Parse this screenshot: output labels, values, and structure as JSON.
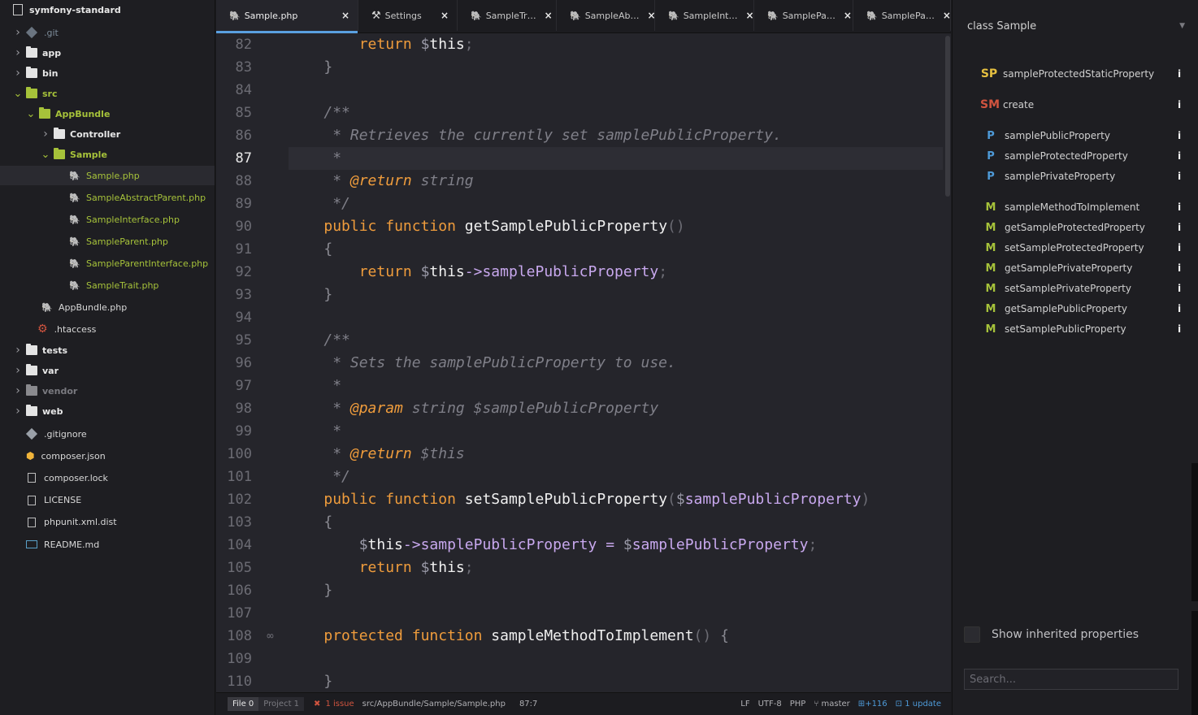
{
  "tree": {
    "root": "symfony-standard",
    "items": [
      {
        "label": ".git",
        "kind": "git-dim",
        "depth": 1,
        "chev": "closed"
      },
      {
        "label": "app",
        "kind": "folder",
        "depth": 1,
        "chev": "closed"
      },
      {
        "label": "bin",
        "kind": "folder",
        "depth": 1,
        "chev": "closed"
      },
      {
        "label": "src",
        "kind": "folder-green",
        "depth": 1,
        "chev": "open"
      },
      {
        "label": "AppBundle",
        "kind": "folder-green",
        "depth": 2,
        "chev": "open"
      },
      {
        "label": "Controller",
        "kind": "folder",
        "depth": 3,
        "chev": "closed"
      },
      {
        "label": "Sample",
        "kind": "folder-green",
        "depth": 3,
        "chev": "open"
      },
      {
        "label": "Sample.php",
        "kind": "php-green",
        "depth": 4,
        "chev": "none",
        "selected": true
      },
      {
        "label": "SampleAbstractParent.php",
        "kind": "php-green",
        "depth": 4,
        "chev": "none"
      },
      {
        "label": "SampleInterface.php",
        "kind": "php-green",
        "depth": 4,
        "chev": "none"
      },
      {
        "label": "SampleParent.php",
        "kind": "php-green",
        "depth": 4,
        "chev": "none"
      },
      {
        "label": "SampleParentInterface.php",
        "kind": "php-green",
        "depth": 4,
        "chev": "none"
      },
      {
        "label": "SampleTrait.php",
        "kind": "php-green",
        "depth": 4,
        "chev": "none"
      },
      {
        "label": "AppBundle.php",
        "kind": "php",
        "depth": 3,
        "chev": "none"
      },
      {
        "label": ".htaccess",
        "kind": "gear",
        "depth": 2,
        "chev": "none"
      },
      {
        "label": "tests",
        "kind": "folder",
        "depth": 1,
        "chev": "closed"
      },
      {
        "label": "var",
        "kind": "folder",
        "depth": 1,
        "chev": "closed"
      },
      {
        "label": "vendor",
        "kind": "folder-dim",
        "depth": 1,
        "chev": "closed"
      },
      {
        "label": "web",
        "kind": "folder",
        "depth": 1,
        "chev": "closed"
      },
      {
        "label": ".gitignore",
        "kind": "git",
        "depth": 1,
        "chev": "none"
      },
      {
        "label": "composer.json",
        "kind": "composer",
        "depth": 1,
        "chev": "none"
      },
      {
        "label": "composer.lock",
        "kind": "file",
        "depth": 1,
        "chev": "none"
      },
      {
        "label": "LICENSE",
        "kind": "file",
        "depth": 1,
        "chev": "none"
      },
      {
        "label": "phpunit.xml.dist",
        "kind": "file",
        "depth": 1,
        "chev": "none"
      },
      {
        "label": "README.md",
        "kind": "readme",
        "depth": 1,
        "chev": "none"
      }
    ]
  },
  "tabs": [
    {
      "label": "Sample.php",
      "icon": "php-icon",
      "active": true
    },
    {
      "label": "Settings",
      "icon": "tools-icon",
      "active": false
    },
    {
      "label": "SampleTr…",
      "icon": "php-icon",
      "active": false
    },
    {
      "label": "SampleAb…",
      "icon": "php-icon",
      "active": false
    },
    {
      "label": "SampleInt…",
      "icon": "php-icon",
      "active": false
    },
    {
      "label": "SamplePa…",
      "icon": "php-icon",
      "active": false
    },
    {
      "label": "SamplePa…",
      "icon": "php-icon",
      "active": false
    }
  ],
  "editor": {
    "current_line": 87,
    "lines": [
      {
        "n": "82",
        "t": [
          [
            "        ",
            ""
          ],
          [
            "return",
            "kw"
          ],
          [
            " ",
            ""
          ],
          [
            "$",
            "dollar"
          ],
          [
            "this",
            "fn"
          ],
          [
            ";",
            "punc"
          ]
        ]
      },
      {
        "n": "83",
        "t": [
          [
            "    ",
            ""
          ],
          [
            "}",
            "brace"
          ]
        ]
      },
      {
        "n": "84",
        "t": []
      },
      {
        "n": "85",
        "t": [
          [
            "    ",
            ""
          ],
          [
            "/**",
            "cmt"
          ]
        ]
      },
      {
        "n": "86",
        "t": [
          [
            "     ",
            ""
          ],
          [
            "* Retrieves the currently set samplePublicProperty.",
            "cmt"
          ]
        ]
      },
      {
        "n": "87",
        "t": [
          [
            "     ",
            ""
          ],
          [
            "*",
            "cmt"
          ]
        ]
      },
      {
        "n": "88",
        "t": [
          [
            "     ",
            ""
          ],
          [
            "* ",
            "cmt"
          ],
          [
            "@return",
            "tag"
          ],
          [
            " string",
            "cmt"
          ]
        ]
      },
      {
        "n": "89",
        "t": [
          [
            "     ",
            ""
          ],
          [
            "*/",
            "cmt"
          ]
        ]
      },
      {
        "n": "90",
        "t": [
          [
            "    ",
            ""
          ],
          [
            "public",
            "kw"
          ],
          [
            " ",
            ""
          ],
          [
            "function",
            "kw"
          ],
          [
            " ",
            ""
          ],
          [
            "getSamplePublicProperty",
            "fn"
          ],
          [
            "()",
            "punc"
          ]
        ]
      },
      {
        "n": "91",
        "t": [
          [
            "    ",
            ""
          ],
          [
            "{",
            "brace"
          ]
        ]
      },
      {
        "n": "92",
        "t": [
          [
            "        ",
            ""
          ],
          [
            "return",
            "kw"
          ],
          [
            " ",
            ""
          ],
          [
            "$",
            "dollar"
          ],
          [
            "this",
            "fn"
          ],
          [
            "->",
            "op"
          ],
          [
            "samplePublicProperty",
            "var"
          ],
          [
            ";",
            "punc"
          ]
        ]
      },
      {
        "n": "93",
        "t": [
          [
            "    ",
            ""
          ],
          [
            "}",
            "brace"
          ]
        ]
      },
      {
        "n": "94",
        "t": []
      },
      {
        "n": "95",
        "t": [
          [
            "    ",
            ""
          ],
          [
            "/**",
            "cmt"
          ]
        ]
      },
      {
        "n": "96",
        "t": [
          [
            "     ",
            ""
          ],
          [
            "* Sets the samplePublicProperty to use.",
            "cmt"
          ]
        ]
      },
      {
        "n": "97",
        "t": [
          [
            "     ",
            ""
          ],
          [
            "*",
            "cmt"
          ]
        ]
      },
      {
        "n": "98",
        "t": [
          [
            "     ",
            ""
          ],
          [
            "* ",
            "cmt"
          ],
          [
            "@param",
            "tag"
          ],
          [
            " string $samplePublicProperty",
            "cmt"
          ]
        ]
      },
      {
        "n": "99",
        "t": [
          [
            "     ",
            ""
          ],
          [
            "*",
            "cmt"
          ]
        ]
      },
      {
        "n": "100",
        "t": [
          [
            "     ",
            ""
          ],
          [
            "* ",
            "cmt"
          ],
          [
            "@return",
            "tag"
          ],
          [
            " $this",
            "cmt"
          ]
        ]
      },
      {
        "n": "101",
        "t": [
          [
            "     ",
            ""
          ],
          [
            "*/",
            "cmt"
          ]
        ]
      },
      {
        "n": "102",
        "t": [
          [
            "    ",
            ""
          ],
          [
            "public",
            "kw"
          ],
          [
            " ",
            ""
          ],
          [
            "function",
            "kw"
          ],
          [
            " ",
            ""
          ],
          [
            "setSamplePublicProperty",
            "fn"
          ],
          [
            "(",
            "punc"
          ],
          [
            "$",
            "dollar"
          ],
          [
            "samplePublicProperty",
            "var"
          ],
          [
            ")",
            "punc"
          ]
        ]
      },
      {
        "n": "103",
        "t": [
          [
            "    ",
            ""
          ],
          [
            "{",
            "brace"
          ]
        ]
      },
      {
        "n": "104",
        "t": [
          [
            "        ",
            ""
          ],
          [
            "$",
            "dollar"
          ],
          [
            "this",
            "fn"
          ],
          [
            "->",
            "op"
          ],
          [
            "samplePublicProperty",
            "var"
          ],
          [
            " ",
            ""
          ],
          [
            "=",
            "op"
          ],
          [
            " ",
            ""
          ],
          [
            "$",
            "dollar"
          ],
          [
            "samplePublicProperty",
            "var"
          ],
          [
            ";",
            "punc"
          ]
        ]
      },
      {
        "n": "105",
        "t": [
          [
            "        ",
            ""
          ],
          [
            "return",
            "kw"
          ],
          [
            " ",
            ""
          ],
          [
            "$",
            "dollar"
          ],
          [
            "this",
            "fn"
          ],
          [
            ";",
            "punc"
          ]
        ]
      },
      {
        "n": "106",
        "t": [
          [
            "    ",
            ""
          ],
          [
            "}",
            "brace"
          ]
        ]
      },
      {
        "n": "107",
        "t": []
      },
      {
        "n": "108",
        "t": [
          [
            "    ",
            ""
          ],
          [
            "protected",
            "kw"
          ],
          [
            " ",
            ""
          ],
          [
            "function",
            "kw"
          ],
          [
            " ",
            ""
          ],
          [
            "sampleMethodToImplement",
            "fn"
          ],
          [
            "()",
            "punc"
          ],
          [
            " ",
            ""
          ],
          [
            "{",
            "brace"
          ]
        ],
        "marker": "link"
      },
      {
        "n": "109",
        "t": []
      },
      {
        "n": "110",
        "t": [
          [
            "    ",
            ""
          ],
          [
            "}",
            "brace"
          ]
        ]
      }
    ]
  },
  "outline": {
    "class_label": "class Sample",
    "members": [
      {
        "badge": "SP",
        "name": "sampleProtectedStaticProperty",
        "group": 0
      },
      {
        "badge": "SM",
        "name": "create",
        "group": 1
      },
      {
        "badge": "P",
        "name": "samplePublicProperty",
        "group": 2
      },
      {
        "badge": "P",
        "name": "sampleProtectedProperty",
        "group": 2
      },
      {
        "badge": "P",
        "name": "samplePrivateProperty",
        "group": 2
      },
      {
        "badge": "M",
        "name": "sampleMethodToImplement",
        "group": 3
      },
      {
        "badge": "M",
        "name": "getSampleProtectedProperty",
        "group": 3
      },
      {
        "badge": "M",
        "name": "setSampleProtectedProperty",
        "group": 3
      },
      {
        "badge": "M",
        "name": "getSamplePrivateProperty",
        "group": 3
      },
      {
        "badge": "M",
        "name": "setSamplePrivateProperty",
        "group": 3
      },
      {
        "badge": "M",
        "name": "getSamplePublicProperty",
        "group": 3
      },
      {
        "badge": "M",
        "name": "setSamplePublicProperty",
        "group": 3
      }
    ],
    "info_glyph": "i",
    "show_inherited_label": "Show inherited properties",
    "search_placeholder": "Search..."
  },
  "status": {
    "file_btn": "File 0",
    "project_btn": "Project 1",
    "issues": "1 issue",
    "path": "src/AppBundle/Sample/Sample.php",
    "cursor": "87:7",
    "line_ending": "LF",
    "encoding": "UTF-8",
    "grammar": "PHP",
    "branch": "master",
    "git_added": "+116",
    "updates": "1 update"
  }
}
